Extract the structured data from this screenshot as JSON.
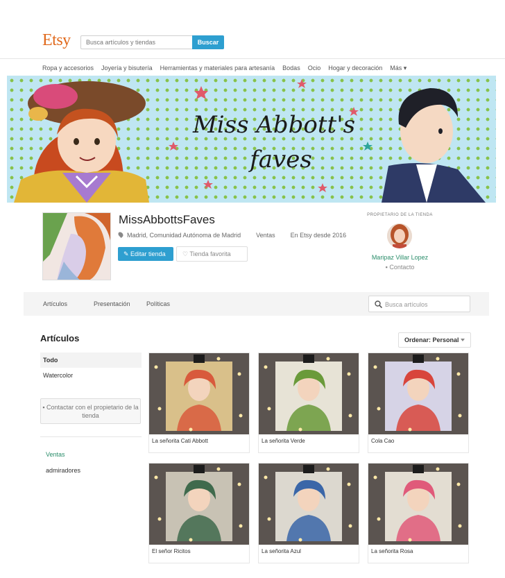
{
  "header": {
    "logo": "Etsy",
    "search_placeholder": "Busca artículos y tiendas",
    "search_button": "Buscar"
  },
  "categories": [
    "Ropa y accesorios",
    "Joyería y bisutería",
    "Herramientas y materiales para artesanía",
    "Bodas",
    "Ocio",
    "Hogar y decoración",
    "Más ▾"
  ],
  "banner": {
    "title_line1": "Miss Abbott's",
    "title_line2": "faves"
  },
  "shop": {
    "name": "MissAbbottsFaves",
    "location": "Madrid, Comunidad Autónoma de Madrid",
    "sales": "Ventas",
    "since": "En Etsy desde 2016",
    "edit_button": "Editar tienda",
    "favorite_button": "Tienda favorita"
  },
  "owner": {
    "label": "PROPIETARIO DE LA TIENDA",
    "name": "Maripaz Villar Lopez",
    "contact": "Contacto"
  },
  "tabs": {
    "items": [
      "Artículos",
      "Presentación",
      "Políticas"
    ],
    "search_placeholder": "Busca artículos"
  },
  "listing": {
    "title": "Artículos",
    "sort_label": "Ordenar: Personal"
  },
  "sidebar": {
    "sections": [
      "Todo",
      "Watercolor"
    ],
    "contact_button": "Contactar con el propietario de la tienda",
    "sales_link": "Ventas",
    "fans_link": "admiradores"
  },
  "items": [
    {
      "title": "La señorita Cati Abbott",
      "bg": "#d9c08a",
      "accent": "#d85a3c"
    },
    {
      "title": "La señorita Verde",
      "bg": "#e7e3d6",
      "accent": "#6a9a3a"
    },
    {
      "title": "Cola Cao",
      "bg": "#d6d3e6",
      "accent": "#d8453b"
    },
    {
      "title": "El señor Ricitos",
      "bg": "#c8c2b4",
      "accent": "#3f6a4c"
    },
    {
      "title": "La señorita Azul",
      "bg": "#dcd8cf",
      "accent": "#3a66a8"
    },
    {
      "title": "La señorita Rosa",
      "bg": "#e3ddd2",
      "accent": "#e05a7a"
    }
  ],
  "colors": {
    "etsy_orange": "#e0691c",
    "primary_blue": "#2e9fd0",
    "green_link": "#2a8d6a"
  }
}
